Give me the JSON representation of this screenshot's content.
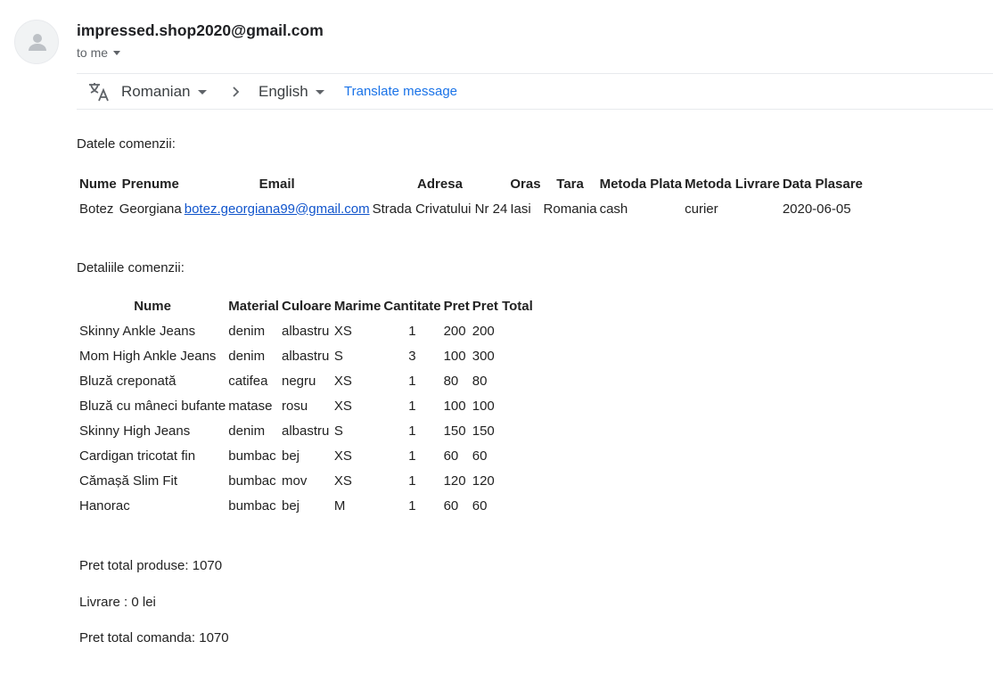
{
  "email": {
    "sender": "impressed.shop2020@gmail.com",
    "recipient_label": "to me"
  },
  "translate_bar": {
    "from_language": "Romanian",
    "to_language": "English",
    "link_label": "Translate message"
  },
  "order_info": {
    "heading": "Datele comenzii:",
    "columns": [
      "Nume",
      "Prenume",
      "Email",
      "Adresa",
      "Oras",
      "Tara",
      "Metoda Plata",
      "Metoda Livrare",
      "Data Plasare"
    ],
    "row": {
      "nume": "Botez",
      "prenume": "Georgiana",
      "email": "botez.georgiana99@gmail.com",
      "adresa": "Strada Crivatului Nr 24",
      "oras": "Iasi",
      "tara": "Romania",
      "metoda_plata": "cash",
      "metoda_livrare": "curier",
      "data_plasare": "2020-06-05"
    }
  },
  "order_details": {
    "heading": "Detaliile comenzii:",
    "columns": [
      "Nume",
      "Material",
      "Culoare",
      "Marime",
      "Cantitate",
      "Pret",
      "Pret Total"
    ],
    "rows": [
      [
        "Skinny Ankle Jeans",
        "denim",
        "albastru",
        "XS",
        "1",
        "200",
        "200"
      ],
      [
        "Mom High Ankle Jeans",
        "denim",
        "albastru",
        "S",
        "3",
        "100",
        "300"
      ],
      [
        "Bluză creponată",
        "catifea",
        "negru",
        "XS",
        "1",
        "80",
        "80"
      ],
      [
        "Bluză cu mâneci bufante",
        "matase",
        "rosu",
        "XS",
        "1",
        "100",
        "100"
      ],
      [
        "Skinny High Jeans",
        "denim",
        "albastru",
        "S",
        "1",
        "150",
        "150"
      ],
      [
        "Cardigan tricotat fin",
        "bumbac",
        "bej",
        "XS",
        "1",
        "60",
        "60"
      ],
      [
        "Cămașă Slim Fit",
        "bumbac",
        "mov",
        "XS",
        "1",
        "120",
        "120"
      ],
      [
        "Hanorac",
        "bumbac",
        "bej",
        "M",
        "1",
        "60",
        "60"
      ]
    ]
  },
  "summary": {
    "products_total": "Pret total produse: 1070",
    "delivery": "Livrare : 0 lei",
    "order_total": "Pret total comanda: 1070"
  }
}
